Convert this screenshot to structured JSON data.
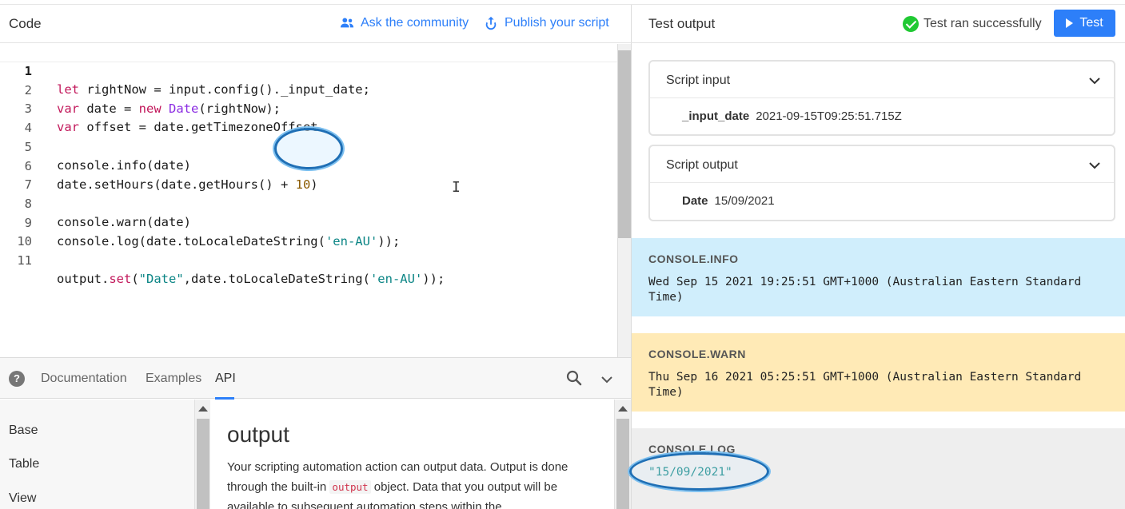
{
  "code_panel": {
    "title": "Code",
    "ask_label": "Ask the community",
    "publish_label": "Publish your script"
  },
  "editor": {
    "line_numbers": [
      "1",
      "2",
      "3",
      "4",
      "5",
      "6",
      "7",
      "8",
      "9",
      "10",
      "11"
    ],
    "lines": [
      "let rightNow = input.config()._input_date;",
      "var date = new Date(rightNow);",
      "var offset = date.getTimezoneOffset",
      "",
      "console.info(date)",
      "date.setHours(date.getHours() + 10)",
      "",
      "console.warn(date)",
      "console.log(date.toLocaleDateString('en-AU'));",
      "",
      "output.set(\"Date\",date.toLocaleDateString('en-AU'));"
    ]
  },
  "docs": {
    "tabs": [
      "Documentation",
      "Examples",
      "API"
    ],
    "active_tab": "API",
    "nav_items": [
      "Base",
      "Table",
      "View"
    ],
    "content_title": "output",
    "content_body_1": "Your scripting automation action can output data. Output is done through the built-in ",
    "content_code": "output",
    "content_body_2": " object. Data that you output will be available to subsequent automation steps within the"
  },
  "test_panel": {
    "title": "Test output",
    "status": "Test ran successfully",
    "test_button": "Test",
    "status_color": "#20c933",
    "accent_color": "#2d7ff9"
  },
  "script_input": {
    "title": "Script input",
    "key": "_input_date",
    "value": "2021-09-15T09:25:51.715Z"
  },
  "script_output": {
    "title": "Script output",
    "key": "Date",
    "value": "15/09/2021"
  },
  "console": {
    "info_label": "CONSOLE.INFO",
    "info_msg": "Wed Sep 15 2021 19:25:51 GMT+1000 (Australian Eastern Standard Time)",
    "warn_label": "CONSOLE.WARN",
    "warn_msg": "Thu Sep 16 2021 05:25:51 GMT+1000 (Australian Eastern Standard Time)",
    "log_label": "CONSOLE.LOG",
    "log_msg": "\"15/09/2021\""
  }
}
